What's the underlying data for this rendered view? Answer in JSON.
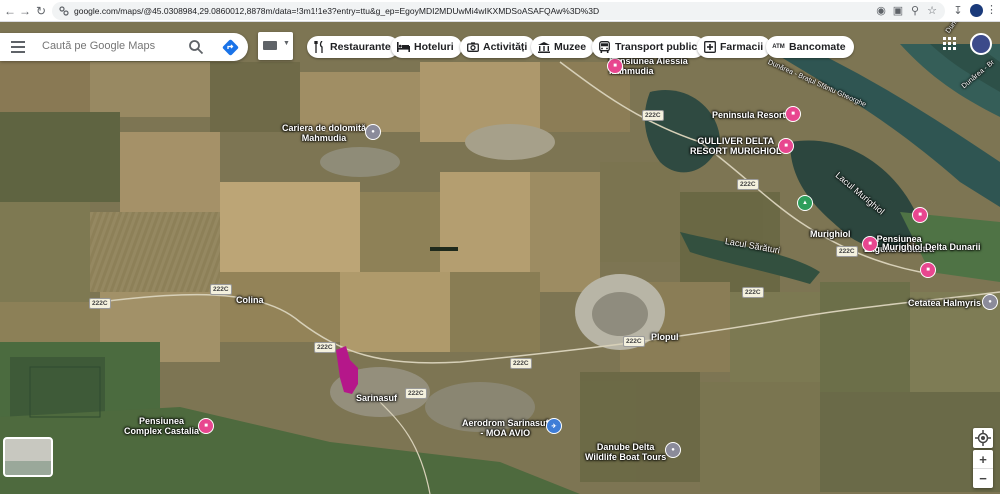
{
  "browser": {
    "url": "google.com/maps/@45.0308984,29.0860012,8878m/data=!3m1!1e3?entry=ttu&g_ep=EgoyMDI2MDUwMi4wIKXMDSoASAFQAw%3D%3D"
  },
  "search": {
    "placeholder": "Caută pe Google Maps"
  },
  "chips": [
    {
      "label": "Restaurante",
      "icon": "fork-knife-icon"
    },
    {
      "label": "Hoteluri",
      "icon": "bed-icon"
    },
    {
      "label": "Activități",
      "icon": "camera-icon"
    },
    {
      "label": "Muzee",
      "icon": "museum-icon"
    },
    {
      "label": "Transport public",
      "icon": "bus-icon"
    },
    {
      "label": "Farmacii",
      "icon": "pharmacy-icon"
    },
    {
      "label": "Bancomate",
      "icon": "atm-icon"
    }
  ],
  "chip_icon_text": {
    "atm": "ATM"
  },
  "places": {
    "pensiunea_alessia": "Pensiunea Alessia\nMahmudia",
    "cariera": "Cariera de dolomită\nMahmudia",
    "peninsula": "Peninsula Resort",
    "gulliver": "GULLIVER DELTA\nRESORT MURIGHIOL",
    "lacul_murighiol": "Lacul Murighiol",
    "pensiunea_laguna": "Pensiunea\nLaguna Albastră",
    "murighiol": "Murighiol",
    "murighiol_delta": "Murighiol Delta Dunarii",
    "lacul_saraturi": "Lacul Sărături",
    "cetatea": "Cetatea Halmyris",
    "colina": "Colina",
    "plopul": "Plopul",
    "sarinasuf": "Sarinasuf",
    "pensiunea_castalia": "Pensiunea\nComplex Castalia",
    "aerodrom": "Aerodrom Sarinasuf\n- MOA AVIO",
    "danube_tours": "Danube Delta\nWildlife Boat Tours",
    "dunarea_sf_gheorghe": "Dunărea - Brațul Sfântu Gheorghe",
    "dunarea_right": "Dunărea - Br",
    "dunarea_top": "Dunărea"
  },
  "roads": [
    "222C"
  ],
  "colors": {
    "hotel_pin": "#e8468f",
    "grey_pin": "#8b8b9a",
    "green_pin": "#2e9e5b",
    "blue_pin": "#3e7dd7",
    "parcel": "#b5178a"
  }
}
